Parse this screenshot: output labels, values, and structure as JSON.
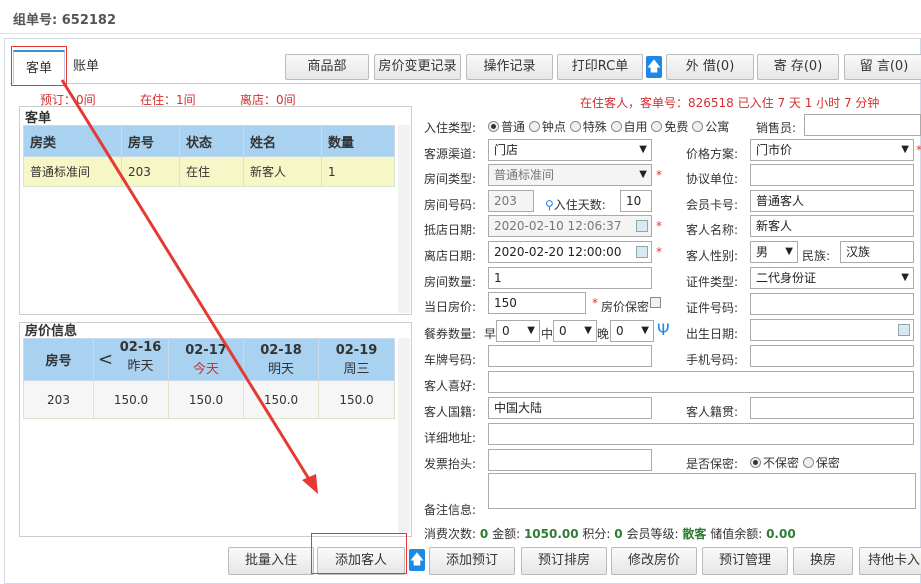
{
  "header": {
    "group_no": "组单号: 652182"
  },
  "tabs": [
    {
      "label": "客单"
    },
    {
      "label": "账单"
    }
  ],
  "toolbar": [
    {
      "label": "商品部"
    },
    {
      "label": "房价变更记录"
    },
    {
      "label": "操作记录"
    },
    {
      "label": "打印RC单"
    },
    {
      "label": "外 借(0)"
    },
    {
      "label": "寄 存(0)"
    },
    {
      "label": "留 言(0)"
    }
  ],
  "up_arrow": "🡅",
  "summary": {
    "reserve": "预订：0间",
    "in_house": "在住：1间",
    "leave": "离店：0间"
  },
  "status_line": "在住客人，客单号：826518 已入住 7 天 1 小时 7 分钟",
  "guest_panel": {
    "title": "客单",
    "columns": [
      "房类",
      "房号",
      "状态",
      "姓名",
      "数量"
    ],
    "rows": [
      [
        "普通标准间",
        "203",
        "在住",
        "新客人",
        "1"
      ]
    ]
  },
  "price_panel": {
    "title": "房价信息",
    "room_header": "房号",
    "dates": [
      {
        "date": "02-16",
        "day": "昨天"
      },
      {
        "date": "02-17",
        "day": "今天"
      },
      {
        "date": "02-18",
        "day": "明天"
      },
      {
        "date": "02-19",
        "day": "周三"
      }
    ],
    "room": "203",
    "prices": [
      "150.0",
      "150.0",
      "150.0",
      "150.0"
    ]
  },
  "form": {
    "checkin_type_label": "入住类型:",
    "checkin_types": [
      "普通",
      "钟点",
      "特殊",
      "自用",
      "免费",
      "公寓"
    ],
    "seller_label": "销售员:",
    "channel_label": "客源渠道:",
    "channel": "门店",
    "price_plan_label": "价格方案:",
    "price_plan": "门市价",
    "room_type_label": "房间类型:",
    "room_type": "普通标准间",
    "agreement_label": "协议单位:",
    "room_no_label": "房间号码:",
    "room_no": "203",
    "days_label": "入住天数:",
    "days": "10",
    "member_card_label": "会员卡号:",
    "member_card": "普通客人",
    "arrive_label": "抵店日期:",
    "arrive": "2020-02-10 12:06:37",
    "guest_name_label": "客人名称:",
    "guest_name": "新客人",
    "leave_label": "离店日期:",
    "leave": "2020-02-20 12:00:00",
    "gender_label": "客人性别:",
    "gender": "男",
    "nation_label": "民族:",
    "nation": "汉族",
    "room_count_label": "房间数量:",
    "room_count": "1",
    "id_type_label": "证件类型:",
    "id_type": "二代身份证",
    "day_price_label": "当日房价:",
    "day_price": "150",
    "price_secret_label": "房价保密",
    "id_no_label": "证件号码:",
    "meal_label": "餐券数量:",
    "meal_breakfast": "早",
    "meal_lunch": "中",
    "meal_dinner": "晚",
    "meal_values": [
      "0",
      "0",
      "0"
    ],
    "birth_label": "出生日期:",
    "plate_label": "车牌号码:",
    "phone_label": "手机号码:",
    "hobby_label": "客人喜好:",
    "country_label": "客人国籍:",
    "country": "中国大陆",
    "origin_label": "客人籍贯:",
    "address_label": "详细地址:",
    "invoice_label": "发票抬头:",
    "secret_label": "是否保密:",
    "secret_options": [
      "不保密",
      "保密"
    ],
    "remark_label": "备注信息:"
  },
  "stats": {
    "visits_label": "消费次数:",
    "visits": "0",
    "amount_label": "金额:",
    "amount": "1050.00",
    "points_label": "积分:",
    "points": "0",
    "level_label": "会员等级:",
    "level": "散客",
    "balance_label": "储值余额:",
    "balance": "0.00"
  },
  "bottom_buttons": [
    {
      "label": "批量入住"
    },
    {
      "label": "添加客人"
    },
    {
      "label": "添加预订"
    },
    {
      "label": "预订排房"
    },
    {
      "label": "修改房价"
    },
    {
      "label": "预订管理"
    },
    {
      "label": "换房"
    },
    {
      "label": "持他卡入"
    }
  ],
  "colors": {
    "accent": "#1e88e5",
    "red": "#d32f2f",
    "header": "#a9d1f0",
    "selected_row": "#f6f6c6"
  }
}
